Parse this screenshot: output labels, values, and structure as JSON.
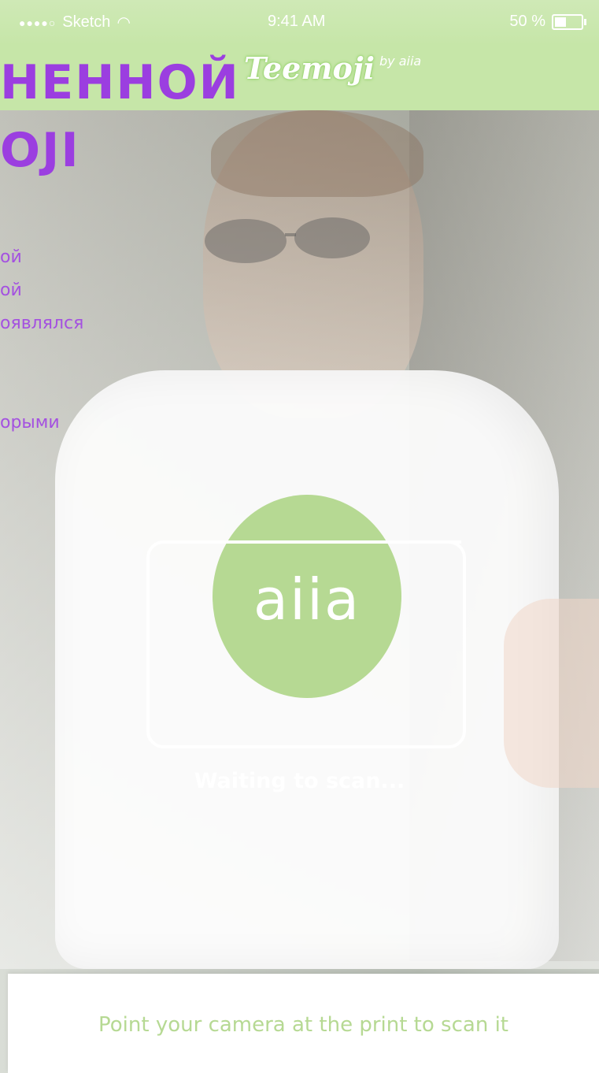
{
  "status_bar": {
    "carrier": "Sketch",
    "time": "9:41 AM",
    "battery": "50 %",
    "battery_level": 0.5
  },
  "nav": {
    "brand": "Teemoji",
    "by": "by aiia"
  },
  "overlay": {
    "title": "НЕННОЙ\nOJI",
    "lines": [
      "ой",
      "ой",
      "оявлялся",
      "орыми"
    ]
  },
  "scanner": {
    "logo_text": "aiia",
    "status": "Waiting to scan..."
  },
  "bottom": {
    "hint": "Point your camera at the print to scan it"
  },
  "colors": {
    "accent_green": "#b6d993",
    "overlay_purple": "#9b3ee0"
  }
}
